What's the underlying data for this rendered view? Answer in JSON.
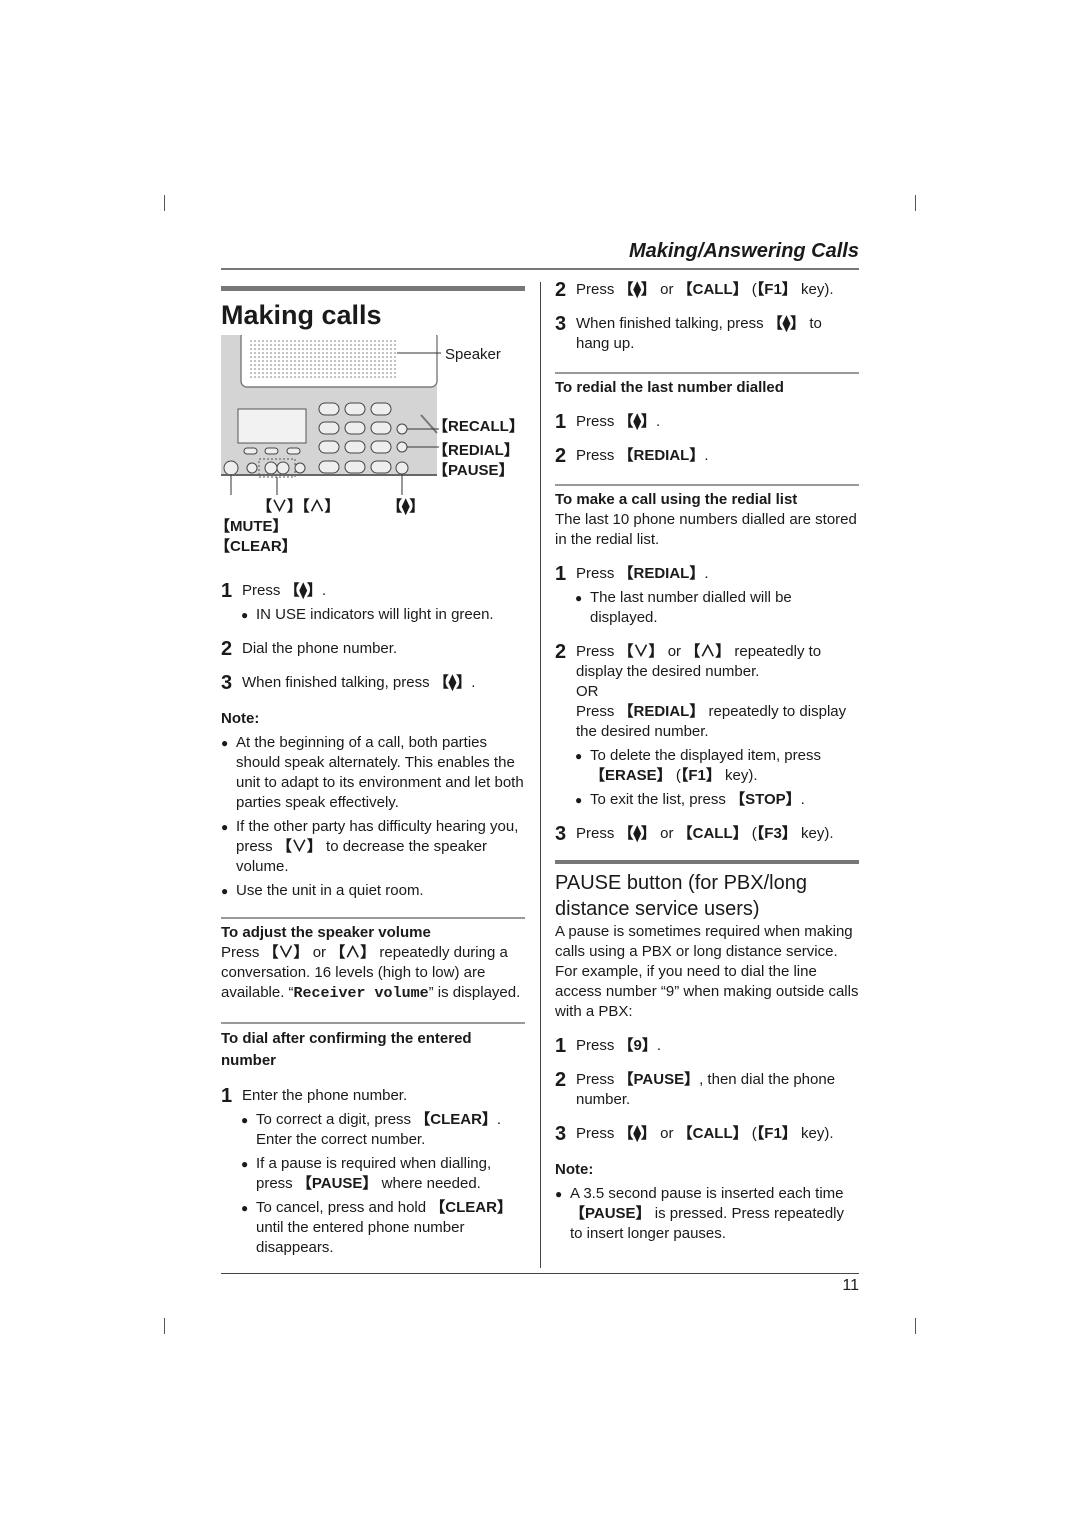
{
  "header": {
    "section_title": "Making/Answering Calls"
  },
  "page_number": "11",
  "icons": {
    "speaker_phone": "speakerphone-icon",
    "down": "∨",
    "up": "∧"
  },
  "left": {
    "title": "Making calls",
    "diagram": {
      "speaker": "Speaker",
      "recall": "【RECALL】",
      "redial": "【REDIAL】",
      "pause": "【PAUSE】",
      "down_up": "【∨】【∧】",
      "sp": "【⧫】",
      "mute": "【MUTE】",
      "clear": "【CLEAR】"
    },
    "steps": [
      {
        "num": "1",
        "pre": "Press ",
        "key": "【⧫】",
        "post": ".",
        "bullet": "IN USE indicators will light in green."
      },
      {
        "num": "2",
        "text": "Dial the phone number."
      },
      {
        "num": "3",
        "pre": "When finished talking, press ",
        "key": "【⧫】",
        "post": "."
      }
    ],
    "note": {
      "heading": "Note:",
      "items": [
        "At the beginning of a call, both parties should speak alternately. This enables the unit to adapt to its environment and let both parties speak effectively.",
        {
          "pre": "If the other party has difficulty hearing you, press ",
          "key": "【∨】",
          "post": " to decrease the speaker volume."
        },
        "Use the unit in a quiet room."
      ]
    },
    "adjust": {
      "heading": "To adjust the speaker volume",
      "pre": "Press ",
      "key1": "【∨】",
      "mid": " or ",
      "key2": "【∧】",
      "post": " repeatedly during a conversation. 16 levels (high to low) are available. “",
      "mono": "Receiver volume",
      "end": "” is displayed."
    },
    "dial_confirm": {
      "heading": "To dial after confirming the entered number",
      "step_num": "1",
      "step_text": "Enter the phone number.",
      "bullets": [
        {
          "pre": "To correct a digit, press ",
          "key": "【CLEAR】",
          "post": ". Enter the correct number."
        },
        {
          "pre": "If a pause is required when dialling, press ",
          "key": "【PAUSE】",
          "post": " where needed."
        },
        {
          "pre": "To cancel, press and hold ",
          "key": "【CLEAR】",
          "post": " until the entered phone number disappears."
        }
      ]
    }
  },
  "right": {
    "cont_steps": [
      {
        "num": "2",
        "pre": "Press ",
        "key": "【⧫】",
        "mid": " or ",
        "key2": "【CALL】",
        "post": " (",
        "key3": "【F1】",
        "end": " key)."
      },
      {
        "num": "3",
        "pre": "When finished talking, press ",
        "key": "【⧫】",
        "post": " to hang up."
      }
    ],
    "redial_last": {
      "heading": "To redial the last number dialled",
      "steps": [
        {
          "num": "1",
          "pre": "Press ",
          "key": "【⧫】",
          "post": "."
        },
        {
          "num": "2",
          "pre": "Press ",
          "key": "【REDIAL】",
          "post": "."
        }
      ]
    },
    "redial_list": {
      "heading": "To make a call using the redial list",
      "intro": "The last 10 phone numbers dialled are stored in the redial list.",
      "step1": {
        "num": "1",
        "pre": "Press ",
        "key": "【REDIAL】",
        "post": ".",
        "bullet": "The last number dialled will be displayed."
      },
      "step2": {
        "num": "2",
        "pre": "Press ",
        "key1": "【∨】",
        "mid": " or ",
        "key2": "【∧】",
        "post": " repeatedly to display the desired number.",
        "or": "OR",
        "alt_pre": "Press ",
        "alt_key": "【REDIAL】",
        "alt_post": " repeatedly to display the desired number.",
        "b1_pre": "To delete the displayed item, press ",
        "b1_key": "【ERASE】",
        "b1_mid": " (",
        "b1_key2": "【F1】",
        "b1_post": " key).",
        "b2_pre": "To exit the list, press ",
        "b2_key": "【STOP】",
        "b2_post": "."
      },
      "step3": {
        "num": "3",
        "pre": "Press ",
        "key": "【⧫】",
        "mid": " or ",
        "key2": "【CALL】",
        "post": " (",
        "key3": "【F3】",
        "end": " key)."
      }
    },
    "pause_section": {
      "heading": "PAUSE button (for PBX/long distance service users)",
      "intro1": "A pause is sometimes required when making calls using a PBX or long distance service.",
      "intro2": "For example, if you need to dial the line access number “9” when making outside calls with a PBX:",
      "steps": [
        {
          "num": "1",
          "pre": "Press ",
          "key": "【9】",
          "post": "."
        },
        {
          "num": "2",
          "pre": "Press ",
          "key": "【PAUSE】",
          "post": ", then dial the phone number."
        },
        {
          "num": "3",
          "pre": "Press ",
          "key": "【⧫】",
          "mid": " or ",
          "key2": "【CALL】",
          "post3": " (",
          "key3": "【F1】",
          "end": " key)."
        }
      ],
      "note_heading": "Note:",
      "note_pre": "A 3.5 second pause is inserted each time ",
      "note_key": "【PAUSE】",
      "note_post": " is pressed. Press repeatedly to insert longer pauses."
    }
  }
}
